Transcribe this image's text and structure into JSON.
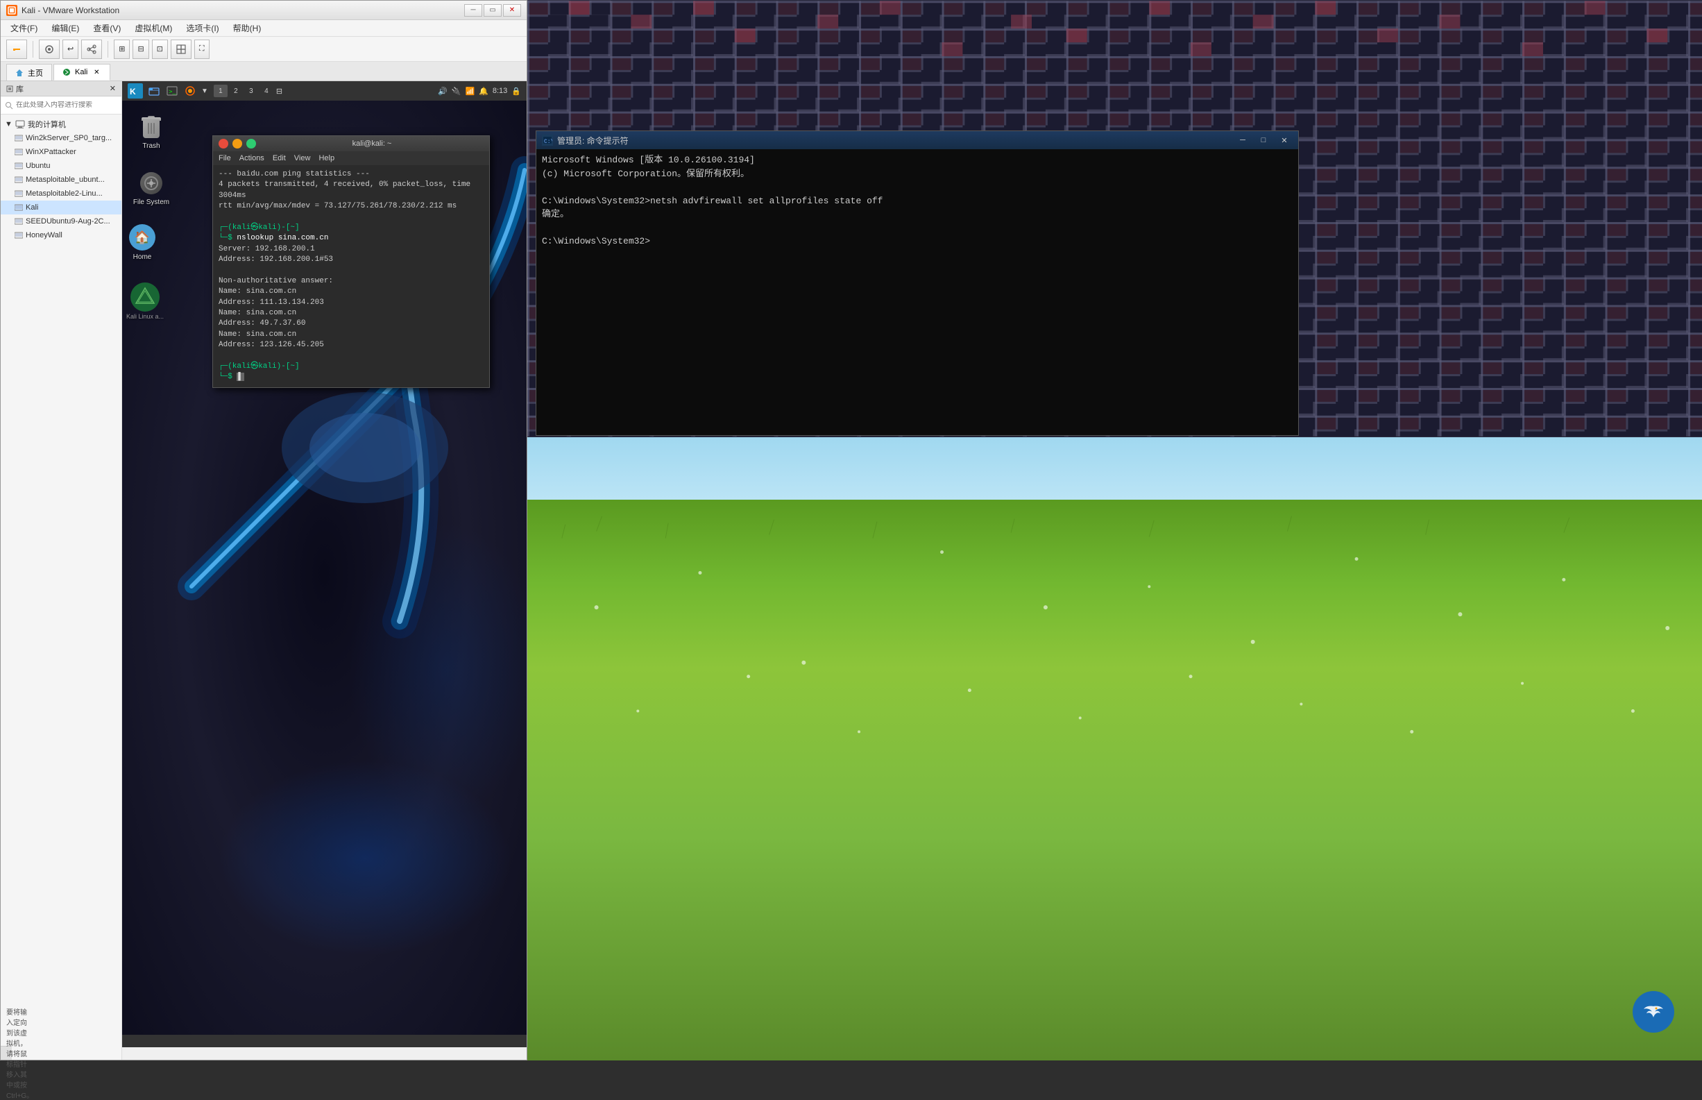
{
  "vmware": {
    "title": "Kali - VMware Workstation",
    "icon_label": "K",
    "menu_items": [
      "文件(F)",
      "编辑(E)",
      "查看(V)",
      "虚拟机(M)",
      "选项卡(I)",
      "帮助(H)"
    ],
    "tabs": [
      {
        "label": "主页",
        "active": false,
        "closable": false
      },
      {
        "label": "Kali",
        "active": true,
        "closable": true
      }
    ],
    "statusbar_text": "要将输入定向到该虚拟机，请将鼠标指针移入其中或按 Ctrl+G。"
  },
  "sidebar": {
    "header_text": "库",
    "search_placeholder": "在此处键入内容进行搜索",
    "group_label": "我的计算机",
    "items": [
      "Win2kServer_SP0_targ...",
      "WinXPattacker",
      "Ubuntu",
      "Metasploitable_ubunt...",
      "Metasploitable2-Linu...",
      "Kali",
      "SEEDUbuntu9-Aug-2C...",
      "HoneyWall"
    ]
  },
  "kali_desktop": {
    "icons": [
      {
        "label": "Trash"
      },
      {
        "label": "File System"
      }
    ],
    "topbar": {
      "workspace_numbers": [
        "1",
        "2",
        "3",
        "4"
      ],
      "time": "8:13"
    },
    "panel_item_label": "Kali Linux a...",
    "home_label": "Home"
  },
  "terminal": {
    "title": "kali@kali: ~",
    "menu_items": [
      "File",
      "Actions",
      "Edit",
      "View",
      "Help"
    ],
    "content_lines": [
      "--- baidu.com ping statistics ---",
      "4 packets transmitted, 4 received, 0% packet_loss, time 3004ms",
      "rtt min/avg/max/mdev = 73.127/75.261/78.230/2.212 ms",
      "",
      "┌─(kali@kali)-[~]",
      "└─$ nslookup sina.com.cn",
      "Server:         192.168.200.1",
      "Address:        192.168.200.1#53",
      "",
      "Non-authoritative answer:",
      "Name:   sina.com.cn",
      "Address: 111.13.134.203",
      "Name:   sina.com.cn",
      "Address: 49.7.37.60",
      "Name:   sina.com.cn",
      "Address: 123.126.45.205",
      "",
      "┌─(kali@kali)-[~]",
      "└─$ "
    ]
  },
  "cmd_window": {
    "title": "管理员: 命令提示符",
    "content": [
      "Microsoft Windows [版本 10.0.26100.3194]",
      "(c) Microsoft Corporation。保留所有权利。",
      "",
      "C:\\Windows\\System32>netsh advfirewall set allprofiles state off",
      "确定。",
      "",
      "C:\\Windows\\System32>"
    ]
  },
  "icons": {
    "trash": "🗑",
    "home": "🏠",
    "close": "✕",
    "minimize": "─",
    "maximize": "□",
    "search": "🔍",
    "arrow_right": "▶",
    "bird": "🕊"
  }
}
